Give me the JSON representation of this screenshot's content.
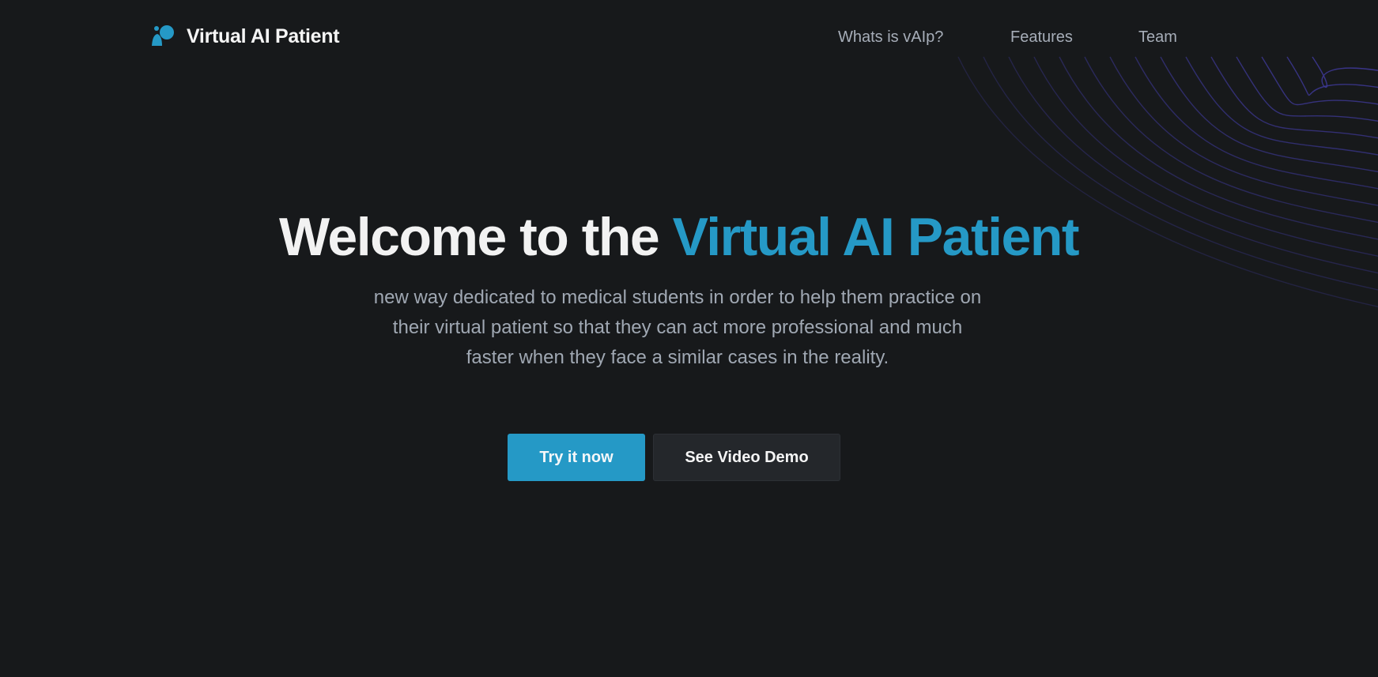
{
  "nav": {
    "brand": "Virtual AI Patient",
    "brand_icon": "logo-icon",
    "links": [
      "Whats is vAIp?",
      "Features",
      "Team"
    ]
  },
  "hero": {
    "title_plain": "Welcome to the",
    "title_accent": "Virtual AI Patient",
    "description": "new way dedicated to medical students in order to help them practice on their virtual patient so that they can act more professional and much faster when they face a similar cases in the reality.",
    "primary_button": "Try it now",
    "secondary_button": "See Video Demo"
  },
  "colors": {
    "background": "#17191b",
    "accent": "#2599c6",
    "nav_text": "#a6adb8",
    "body_text": "#a0a8b3",
    "secondary_button_bg": "#24272b",
    "wave_lines": "#3f3a9a"
  }
}
